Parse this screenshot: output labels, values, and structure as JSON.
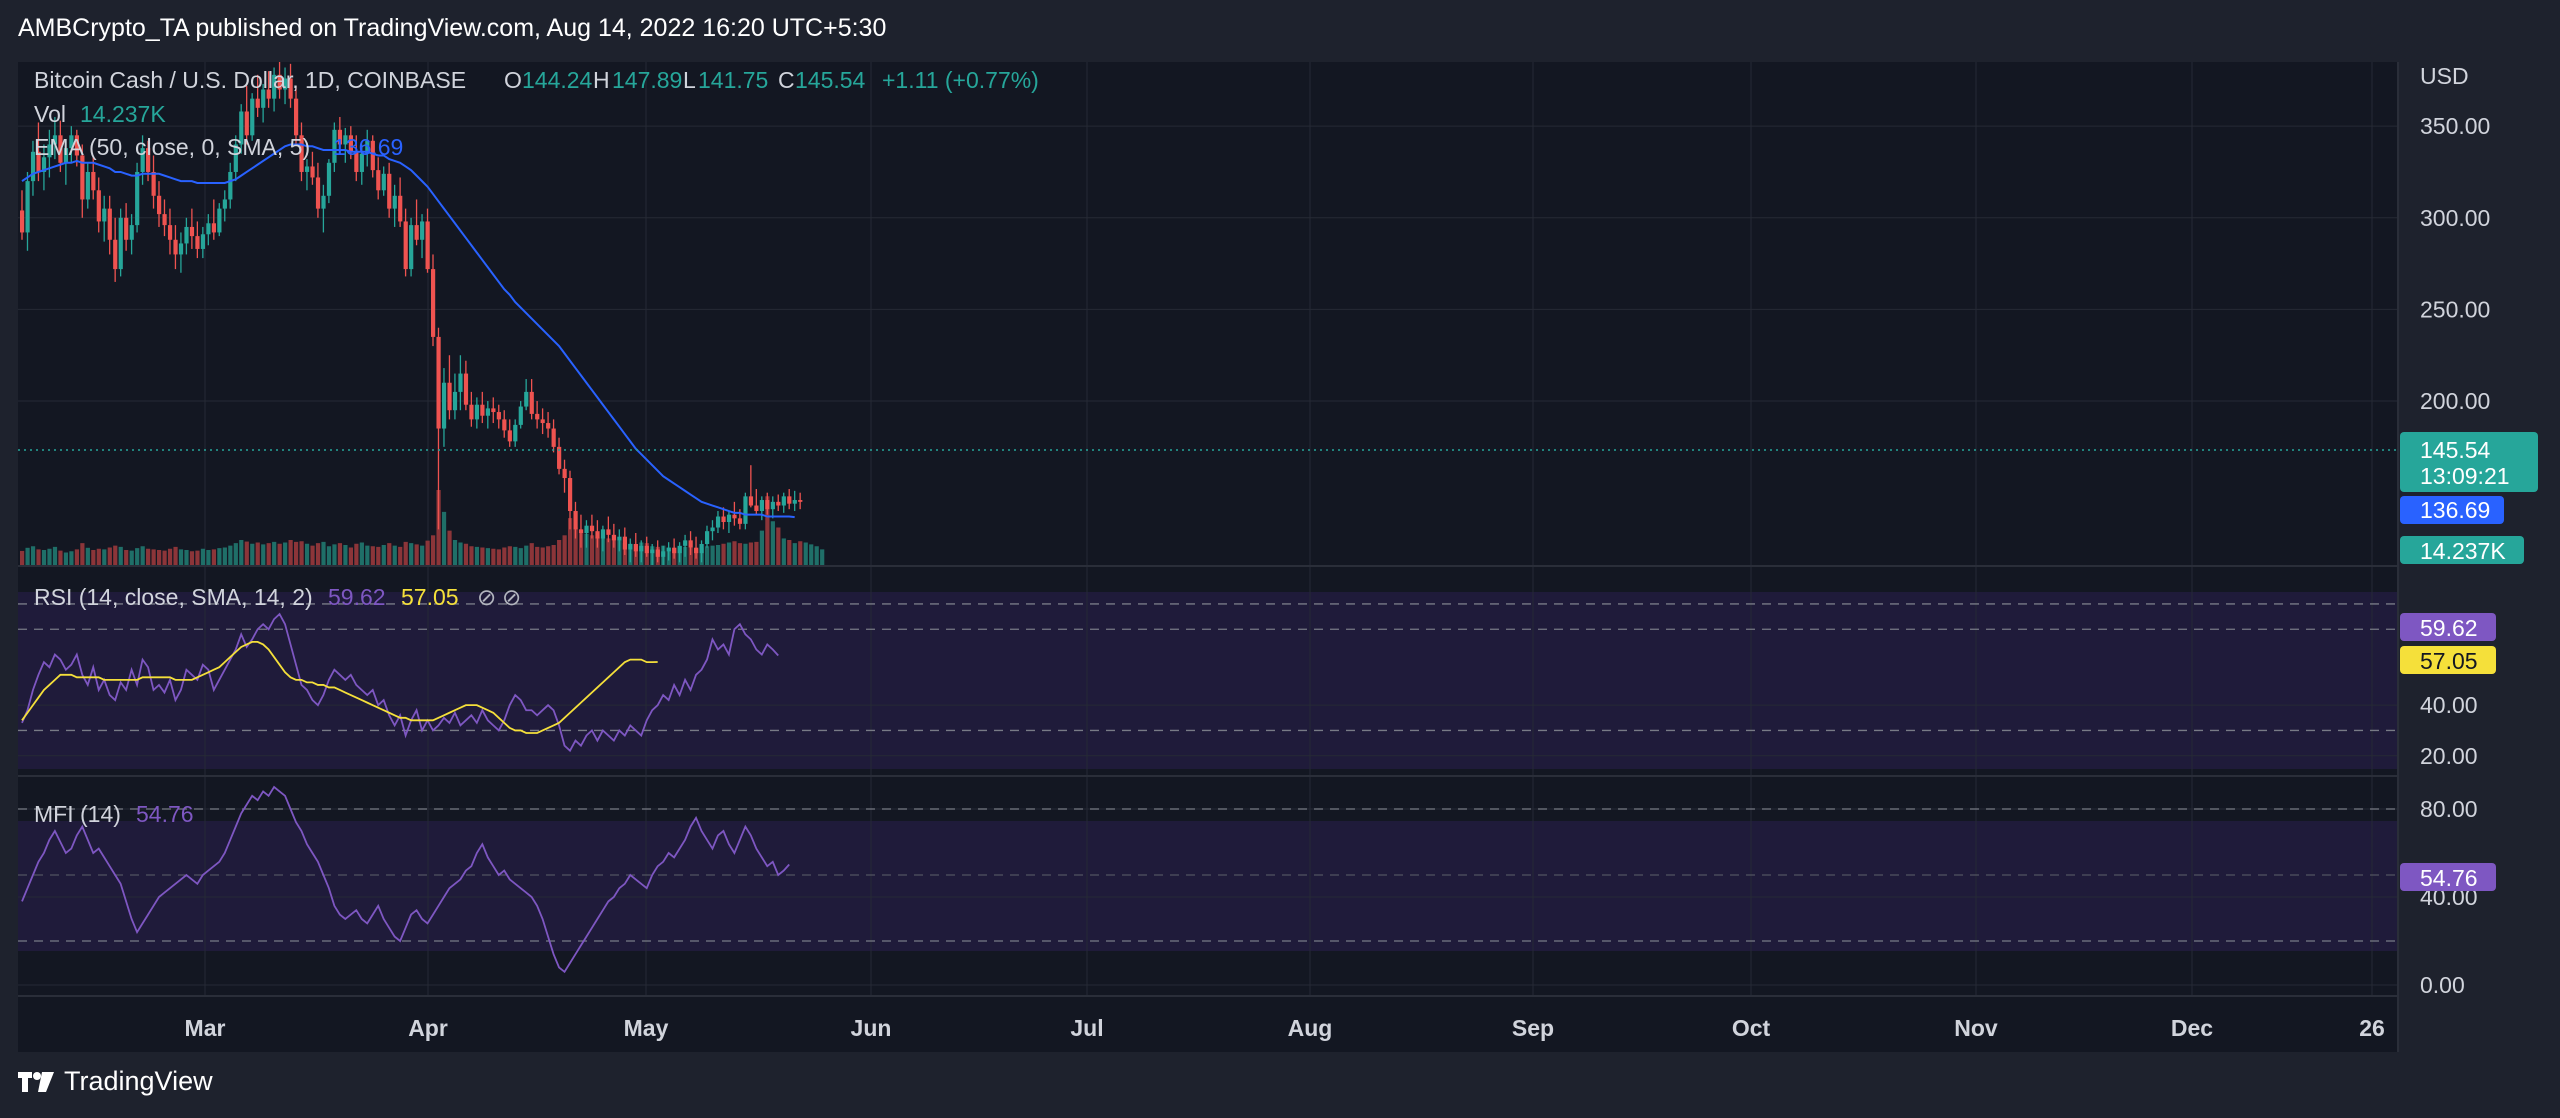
{
  "publish_line": "AMBCrypto_TA published on TradingView.com, Aug 14, 2022 16:20 UTC+5:30",
  "brand": "TradingView",
  "colors": {
    "background": "#1e222d",
    "chart_bg": "#131722",
    "grid": "#262a35",
    "up": "#26a69a",
    "down": "#ef5350",
    "ema": "#2962ff",
    "rsi": "#7e57c2",
    "rsi_ma": "#f5e03a",
    "mfi": "#7e57c2",
    "text": "#d1d4dc",
    "muted": "#b2b5be"
  },
  "legend": {
    "symbol": "Bitcoin Cash / U.S. Dollar, 1D, COINBASE",
    "o_label": "O",
    "o": "144.24",
    "h_label": "H",
    "h": "147.89",
    "l_label": "L",
    "l": "141.75",
    "c_label": "C",
    "c": "145.54",
    "change": "+1.11 (+0.77%)",
    "vol_label": "Vol",
    "vol": "14.237K",
    "ema_label": "EMA (50, close, 0, SMA, 5)",
    "ema": "136.69",
    "rsi_label": "RSI (14, close, SMA, 14, 2)",
    "rsi": "59.62",
    "rsi_ma": "57.05",
    "mfi_label": "MFI (14)",
    "mfi": "54.76"
  },
  "price_axis": {
    "currency": "USD",
    "ticks": [
      "350.00",
      "300.00",
      "250.00",
      "200.00"
    ]
  },
  "rsi_axis": {
    "ticks": [
      "40.00",
      "20.00"
    ]
  },
  "mfi_axis": {
    "ticks": [
      "80.00",
      "40.00",
      "0.00"
    ]
  },
  "badges": {
    "last_price": "145.54",
    "countdown": "13:09:21",
    "ema": "136.69",
    "volume": "14.237K",
    "rsi": "59.62",
    "rsi_ma": "57.05",
    "mfi": "54.76"
  },
  "time_axis": {
    "labels": [
      "Mar",
      "Apr",
      "May",
      "Jun",
      "Jul",
      "Aug",
      "Sep",
      "Oct",
      "Nov",
      "Dec",
      "26"
    ]
  },
  "chart_data": {
    "type": "candlestick",
    "title": "Bitcoin Cash / U.S. Dollar, 1D, COINBASE",
    "ylim_price": [
      110,
      385
    ],
    "candles_ohlc": [
      [
        304,
        315,
        288,
        292
      ],
      [
        292,
        325,
        282,
        320
      ],
      [
        320,
        342,
        312,
        336
      ],
      [
        336,
        352,
        320,
        325
      ],
      [
        325,
        340,
        315,
        333
      ],
      [
        333,
        348,
        322,
        340
      ],
      [
        340,
        355,
        332,
        345
      ],
      [
        345,
        353,
        325,
        330
      ],
      [
        330,
        342,
        318,
        338
      ],
      [
        338,
        350,
        330,
        345
      ],
      [
        345,
        348,
        328,
        334
      ],
      [
        334,
        340,
        300,
        310
      ],
      [
        310,
        330,
        305,
        325
      ],
      [
        325,
        333,
        310,
        315
      ],
      [
        315,
        322,
        292,
        298
      ],
      [
        298,
        312,
        287,
        305
      ],
      [
        305,
        312,
        280,
        288
      ],
      [
        288,
        300,
        265,
        272
      ],
      [
        272,
        305,
        268,
        300
      ],
      [
        300,
        308,
        282,
        288
      ],
      [
        288,
        302,
        280,
        296
      ],
      [
        296,
        330,
        292,
        325
      ],
      [
        325,
        345,
        318,
        338
      ],
      [
        338,
        342,
        320,
        325
      ],
      [
        325,
        334,
        305,
        312
      ],
      [
        312,
        320,
        295,
        302
      ],
      [
        302,
        310,
        290,
        296
      ],
      [
        296,
        305,
        280,
        288
      ],
      [
        288,
        296,
        272,
        280
      ],
      [
        280,
        292,
        270,
        286
      ],
      [
        286,
        300,
        280,
        295
      ],
      [
        295,
        305,
        283,
        290
      ],
      [
        290,
        298,
        278,
        283
      ],
      [
        283,
        295,
        278,
        291
      ],
      [
        291,
        302,
        285,
        297
      ],
      [
        297,
        310,
        288,
        292
      ],
      [
        292,
        308,
        290,
        305
      ],
      [
        305,
        315,
        298,
        310
      ],
      [
        310,
        330,
        305,
        325
      ],
      [
        325,
        345,
        320,
        340
      ],
      [
        340,
        362,
        335,
        358
      ],
      [
        358,
        372,
        340,
        345
      ],
      [
        345,
        368,
        342,
        365
      ],
      [
        365,
        378,
        355,
        360
      ],
      [
        360,
        373,
        352,
        370
      ],
      [
        370,
        380,
        360,
        365
      ],
      [
        365,
        382,
        358,
        378
      ],
      [
        378,
        385,
        365,
        370
      ],
      [
        370,
        382,
        362,
        376
      ],
      [
        376,
        384,
        360,
        365
      ],
      [
        365,
        372,
        340,
        345
      ],
      [
        345,
        352,
        320,
        325
      ],
      [
        325,
        332,
        315,
        328
      ],
      [
        328,
        336,
        318,
        322
      ],
      [
        322,
        330,
        300,
        305
      ],
      [
        305,
        318,
        292,
        312
      ],
      [
        312,
        332,
        308,
        330
      ],
      [
        330,
        352,
        325,
        348
      ],
      [
        348,
        355,
        335,
        340
      ],
      [
        340,
        349,
        330,
        345
      ],
      [
        345,
        350,
        332,
        336
      ],
      [
        336,
        345,
        320,
        325
      ],
      [
        325,
        340,
        318,
        335
      ],
      [
        335,
        348,
        328,
        342
      ],
      [
        342,
        345,
        322,
        326
      ],
      [
        326,
        333,
        310,
        315
      ],
      [
        315,
        328,
        312,
        324
      ],
      [
        324,
        330,
        300,
        305
      ],
      [
        305,
        318,
        295,
        312
      ],
      [
        312,
        322,
        295,
        298
      ],
      [
        298,
        305,
        268,
        272
      ],
      [
        272,
        300,
        268,
        296
      ],
      [
        296,
        310,
        285,
        288
      ],
      [
        288,
        302,
        278,
        298
      ],
      [
        298,
        305,
        270,
        272
      ],
      [
        272,
        280,
        230,
        235
      ],
      [
        235,
        240,
        130,
        185
      ],
      [
        185,
        218,
        175,
        210
      ],
      [
        210,
        225,
        190,
        195
      ],
      [
        195,
        215,
        190,
        205
      ],
      [
        205,
        225,
        195,
        215
      ],
      [
        215,
        222,
        195,
        198
      ],
      [
        198,
        205,
        186,
        190
      ],
      [
        190,
        202,
        185,
        198
      ],
      [
        198,
        205,
        188,
        192
      ],
      [
        192,
        200,
        185,
        196
      ],
      [
        196,
        202,
        188,
        194
      ],
      [
        194,
        198,
        185,
        190
      ],
      [
        190,
        195,
        180,
        184
      ],
      [
        184,
        190,
        175,
        178
      ],
      [
        178,
        190,
        175,
        187
      ],
      [
        187,
        200,
        185,
        197
      ],
      [
        197,
        212,
        195,
        205
      ],
      [
        205,
        212,
        190,
        193
      ],
      [
        193,
        200,
        185,
        190
      ],
      [
        190,
        196,
        182,
        188
      ],
      [
        188,
        194,
        180,
        185
      ],
      [
        185,
        190,
        172,
        175
      ],
      [
        175,
        180,
        160,
        163
      ],
      [
        163,
        168,
        150,
        158
      ],
      [
        158,
        162,
        130,
        140
      ],
      [
        140,
        145,
        125,
        130
      ],
      [
        130,
        138,
        120,
        128
      ],
      [
        128,
        135,
        120,
        132
      ],
      [
        132,
        138,
        125,
        129
      ],
      [
        129,
        135,
        120,
        125
      ],
      [
        125,
        132,
        118,
        130
      ],
      [
        130,
        137,
        123,
        127
      ],
      [
        127,
        133,
        120,
        124
      ],
      [
        124,
        130,
        118,
        126
      ],
      [
        126,
        131,
        116,
        119
      ],
      [
        119,
        125,
        112,
        122
      ],
      [
        122,
        128,
        115,
        118
      ],
      [
        118,
        124,
        112,
        121
      ],
      [
        121,
        126,
        115,
        117
      ],
      [
        117,
        122,
        110,
        119
      ],
      [
        119,
        124,
        112,
        115
      ],
      [
        115,
        121,
        110,
        118
      ],
      [
        118,
        123,
        113,
        120
      ],
      [
        120,
        125,
        114,
        117
      ],
      [
        117,
        123,
        112,
        121
      ],
      [
        121,
        127,
        115,
        124
      ],
      [
        124,
        129,
        116,
        120
      ],
      [
        120,
        126,
        114,
        117
      ],
      [
        117,
        124,
        112,
        122
      ],
      [
        122,
        132,
        120,
        129
      ],
      [
        129,
        135,
        124,
        131
      ],
      [
        131,
        140,
        128,
        137
      ],
      [
        137,
        142,
        130,
        134
      ],
      [
        134,
        140,
        128,
        138
      ],
      [
        138,
        145,
        132,
        136
      ],
      [
        136,
        141,
        130,
        133
      ],
      [
        133,
        150,
        130,
        148
      ],
      [
        148,
        165,
        142,
        143
      ],
      [
        143,
        152,
        138,
        140
      ],
      [
        140,
        148,
        135,
        146
      ],
      [
        146,
        150,
        138,
        141
      ],
      [
        141,
        148,
        136,
        145
      ],
      [
        145,
        149,
        140,
        143
      ],
      [
        143,
        150,
        139,
        148
      ],
      [
        148,
        152,
        141,
        144
      ],
      [
        144,
        151,
        140,
        146
      ],
      [
        146,
        150,
        141,
        145
      ]
    ],
    "ema": [
      320,
      322,
      324,
      325,
      326,
      327,
      328,
      329,
      330,
      330,
      331,
      330,
      330,
      330,
      329,
      328,
      327,
      325,
      325,
      324,
      323,
      323,
      324,
      324,
      324,
      324,
      323,
      322,
      321,
      320,
      320,
      320,
      319,
      319,
      319,
      319,
      319,
      319,
      320,
      321,
      323,
      325,
      327,
      329,
      331,
      333,
      335,
      337,
      339,
      340,
      340,
      340,
      339,
      339,
      338,
      337,
      337,
      337,
      337,
      337,
      336,
      336,
      336,
      336,
      335,
      334,
      334,
      332,
      331,
      330,
      328,
      326,
      323,
      320,
      317,
      313,
      309,
      305,
      301,
      297,
      293,
      289,
      285,
      281,
      277,
      273,
      269,
      265,
      261,
      258,
      254,
      251,
      248,
      245,
      242,
      239,
      236,
      233,
      230,
      226,
      222,
      218,
      214,
      210,
      206,
      202,
      198,
      194,
      190,
      186,
      182,
      178,
      174,
      171,
      168,
      165,
      162,
      159,
      157,
      155,
      153,
      151,
      149,
      147,
      145,
      144,
      143,
      142,
      141,
      140,
      139,
      139,
      138,
      138,
      138,
      138,
      137,
      137,
      137,
      137,
      137,
      136.69
    ],
    "volume": [
      45,
      55,
      60,
      50,
      48,
      52,
      58,
      46,
      40,
      44,
      50,
      70,
      55,
      48,
      52,
      50,
      56,
      62,
      58,
      48,
      46,
      54,
      60,
      52,
      50,
      48,
      46,
      52,
      58,
      50,
      48,
      44,
      46,
      52,
      48,
      50,
      54,
      56,
      62,
      70,
      80,
      75,
      68,
      72,
      66,
      70,
      74,
      68,
      72,
      80,
      74,
      76,
      68,
      62,
      70,
      74,
      60,
      66,
      70,
      64,
      56,
      68,
      72,
      62,
      60,
      58,
      64,
      70,
      62,
      58,
      74,
      70,
      66,
      62,
      78,
      95,
      240,
      170,
      110,
      80,
      72,
      68,
      60,
      58,
      56,
      54,
      52,
      50,
      56,
      60,
      58,
      54,
      62,
      70,
      58,
      56,
      60,
      64,
      80,
      95,
      150,
      120,
      105,
      100,
      95,
      90,
      88,
      85,
      82,
      80,
      70,
      68,
      66,
      72,
      70,
      60,
      58,
      62,
      56,
      54,
      60,
      58,
      55,
      52,
      56,
      60,
      62,
      64,
      68,
      72,
      76,
      70,
      68,
      72,
      74,
      110,
      220,
      140,
      120,
      85,
      80,
      70,
      76,
      72,
      66,
      60,
      50
    ],
    "rsi": [
      33,
      38,
      46,
      52,
      57,
      55,
      60,
      58,
      54,
      56,
      60,
      52,
      48,
      55,
      46,
      50,
      44,
      42,
      49,
      46,
      54,
      48,
      58,
      55,
      46,
      48,
      45,
      50,
      42,
      46,
      54,
      52,
      50,
      56,
      54,
      46,
      50,
      54,
      58,
      62,
      68,
      63,
      66,
      70,
      72,
      70,
      74,
      76,
      72,
      64,
      56,
      48,
      46,
      42,
      40,
      44,
      50,
      54,
      52,
      50,
      52,
      48,
      46,
      44,
      46,
      40,
      42,
      36,
      32,
      36,
      28,
      34,
      38,
      30,
      34,
      30,
      32,
      35,
      33,
      37,
      32,
      34,
      36,
      33,
      38,
      34,
      32,
      30,
      34,
      40,
      44,
      42,
      38,
      38,
      36,
      38,
      40,
      38,
      32,
      24,
      22,
      26,
      24,
      28,
      30,
      26,
      30,
      28,
      26,
      30,
      28,
      32,
      30,
      28,
      34,
      38,
      40,
      44,
      42,
      48,
      44,
      50,
      46,
      52,
      54,
      58,
      66,
      62,
      64,
      60,
      70,
      72,
      68,
      66,
      62,
      60,
      64,
      62,
      59.62
    ],
    "rsi_ma": [
      34,
      37,
      40,
      43,
      46,
      48,
      50,
      52,
      52,
      52,
      51,
      51,
      51,
      51,
      51,
      50,
      50,
      50,
      50,
      50,
      50,
      50,
      51,
      51,
      51,
      51,
      51,
      51,
      50,
      50,
      50,
      50,
      51,
      52,
      53,
      54,
      55,
      57,
      59,
      61,
      63,
      64,
      65,
      65,
      64,
      62,
      59,
      56,
      53,
      51,
      50,
      50,
      49,
      49,
      48,
      48,
      47,
      47,
      46,
      45,
      44,
      43,
      42,
      41,
      40,
      39,
      38,
      37,
      36,
      35,
      35,
      34,
      34,
      34,
      34,
      34,
      35,
      36,
      37,
      38,
      39,
      40,
      40,
      40,
      39,
      38,
      37,
      35,
      33,
      31,
      30,
      30,
      29,
      29,
      29,
      30,
      31,
      32,
      33,
      35,
      37,
      39,
      41,
      43,
      45,
      47,
      49,
      51,
      53,
      55,
      57,
      58,
      58,
      58,
      57,
      57,
      57.05
    ],
    "mfi": [
      38,
      44,
      50,
      56,
      60,
      66,
      70,
      65,
      60,
      62,
      68,
      72,
      66,
      60,
      62,
      58,
      54,
      50,
      46,
      38,
      30,
      24,
      28,
      32,
      36,
      40,
      42,
      44,
      46,
      48,
      50,
      48,
      46,
      50,
      52,
      54,
      56,
      60,
      66,
      72,
      78,
      82,
      86,
      84,
      88,
      86,
      90,
      88,
      86,
      80,
      74,
      70,
      64,
      60,
      56,
      50,
      44,
      36,
      32,
      30,
      32,
      34,
      30,
      28,
      32,
      36,
      30,
      26,
      22,
      20,
      26,
      32,
      34,
      30,
      28,
      32,
      36,
      40,
      44,
      46,
      48,
      52,
      54,
      60,
      64,
      58,
      54,
      50,
      52,
      48,
      46,
      44,
      42,
      40,
      36,
      30,
      22,
      14,
      8,
      6,
      10,
      14,
      18,
      22,
      26,
      30,
      34,
      38,
      40,
      44,
      46,
      50,
      48,
      46,
      44,
      50,
      54,
      56,
      60,
      58,
      62,
      66,
      72,
      76,
      70,
      66,
      62,
      68,
      70,
      64,
      60,
      66,
      72,
      68,
      62,
      58,
      54,
      56,
      50,
      52,
      54.76
    ],
    "price_ticks": [
      350,
      300,
      250,
      200
    ],
    "rsi_ticks": [
      40,
      20
    ],
    "mfi_ticks": [
      80,
      40,
      0
    ],
    "rsi_bands": [
      80,
      70,
      30
    ],
    "mfi_bands": [
      80,
      20
    ]
  }
}
